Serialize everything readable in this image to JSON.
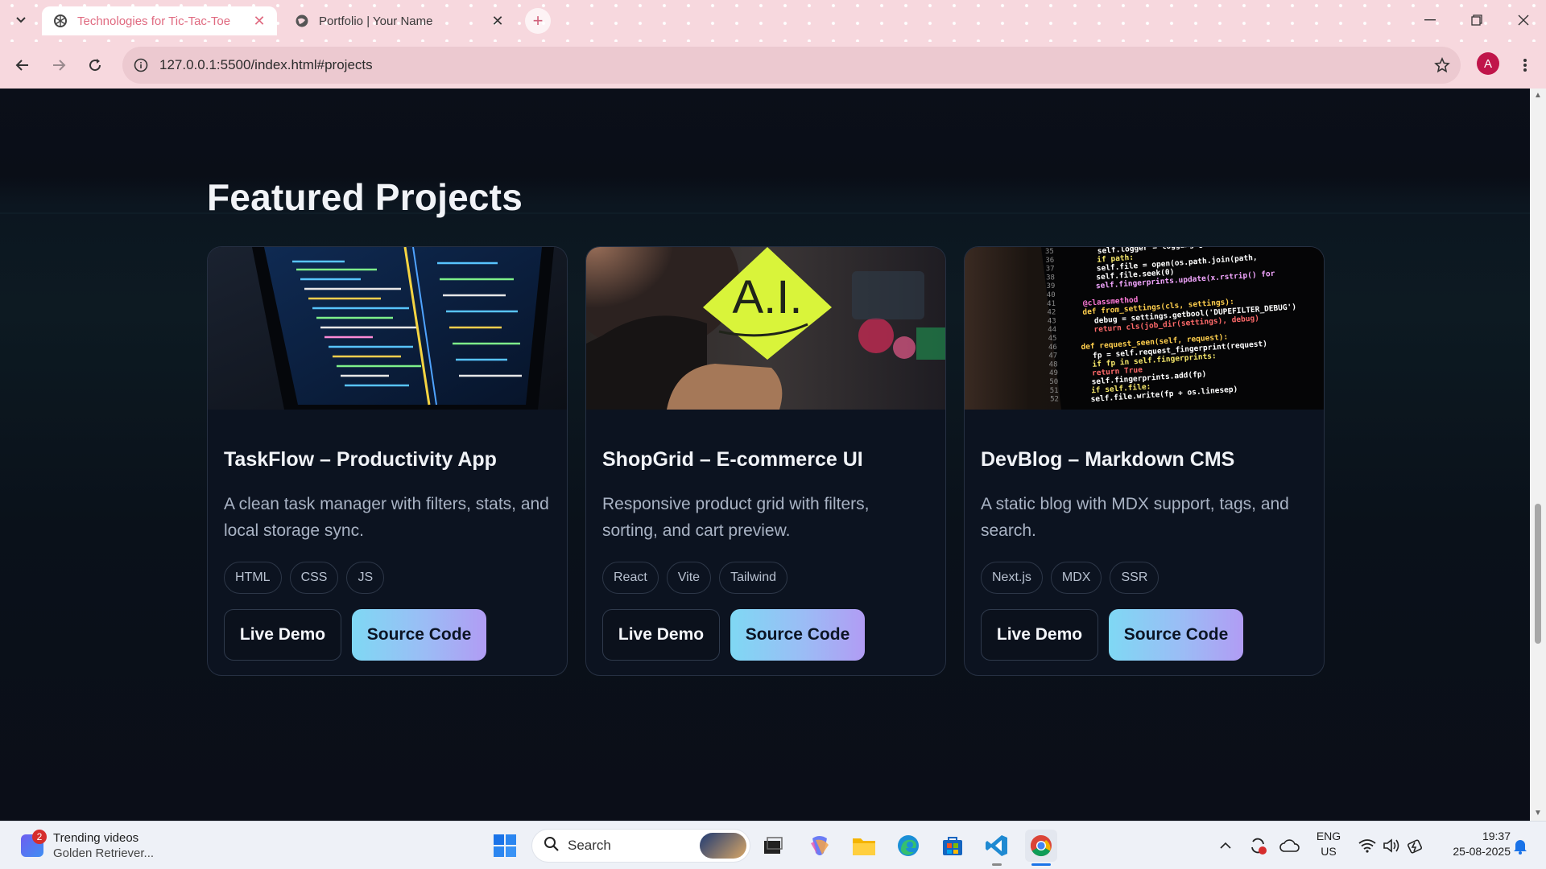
{
  "browser": {
    "tabs": [
      {
        "title": "Technologies for Tic-Tac-Toe",
        "active": true
      },
      {
        "title": "Portfolio | Your Name",
        "active": false
      }
    ],
    "url": "127.0.0.1:5500/index.html#projects",
    "profile_initial": "A",
    "accent": "#f7d8de"
  },
  "page": {
    "section_title": "Featured Projects",
    "projects": [
      {
        "title": "TaskFlow – Productivity App",
        "description": "A clean task manager with filters, stats, and local storage sync.",
        "tags": [
          "HTML",
          "CSS",
          "JS"
        ],
        "demo_label": "Live Demo",
        "source_label": "Source Code",
        "image": "laptop-code-photo"
      },
      {
        "title": "ShopGrid – E-commerce UI",
        "description": "Responsive product grid with filters, sorting, and cart preview.",
        "tags": [
          "React",
          "Vite",
          "Tailwind"
        ],
        "demo_label": "Live Demo",
        "source_label": "Source Code",
        "image": "ai-sticky-note-photo"
      },
      {
        "title": "DevBlog – Markdown CMS",
        "description": "A static blog with MDX support, tags, and search.",
        "tags": [
          "Next.js",
          "MDX",
          "SSR"
        ],
        "demo_label": "Live Demo",
        "source_label": "Source Code",
        "image": "code-screen-photo"
      }
    ],
    "photo_text": {
      "ai_note": "A.I.",
      "code_lines": [
        {
          "num": "35",
          "text": "self.logger = logging.getLogger(__name__)",
          "color": "#ffffff"
        },
        {
          "num": "36",
          "text": "if path:",
          "color": "#f5e76a"
        },
        {
          "num": "37",
          "text": "self.file = open(os.path.join(path,",
          "color": "#ffffff"
        },
        {
          "num": "38",
          "text": "self.file.seek(0)",
          "color": "#ffffff"
        },
        {
          "num": "39",
          "text": "self.fingerprints.update(x.rstrip() for",
          "color": "#f3a6ff"
        },
        {
          "num": "40",
          "text": "",
          "color": "#ffffff"
        },
        {
          "num": "41",
          "text": "@classmethod",
          "color": "#ff7ad9"
        },
        {
          "num": "42",
          "text": "def from_settings(cls, settings):",
          "color": "#ffcf4d"
        },
        {
          "num": "43",
          "text": "debug = settings.getbool('DUPEFILTER_DEBUG')",
          "color": "#ffffff"
        },
        {
          "num": "44",
          "text": "return cls(job_dir(settings), debug)",
          "color": "#ff6a6a"
        },
        {
          "num": "45",
          "text": "",
          "color": "#ffffff"
        },
        {
          "num": "46",
          "text": "def request_seen(self, request):",
          "color": "#ffcf4d"
        },
        {
          "num": "47",
          "text": "fp = self.request_fingerprint(request)",
          "color": "#ffffff"
        },
        {
          "num": "48",
          "text": "if fp in self.fingerprints:",
          "color": "#f5e76a"
        },
        {
          "num": "49",
          "text": "return True",
          "color": "#ff6a6a"
        },
        {
          "num": "50",
          "text": "self.fingerprints.add(fp)",
          "color": "#ffffff"
        },
        {
          "num": "51",
          "text": "if self.file:",
          "color": "#f5e76a"
        },
        {
          "num": "52",
          "text": "self.file.write(fp + os.linesep)",
          "color": "#ffffff"
        }
      ]
    }
  },
  "taskbar": {
    "widget_title": "Trending videos",
    "widget_subtitle": "Golden Retriever...",
    "widget_badge": "2",
    "search_placeholder": "Search",
    "lang_line1": "ENG",
    "lang_line2": "US",
    "time": "19:37",
    "date": "25-08-2025"
  }
}
